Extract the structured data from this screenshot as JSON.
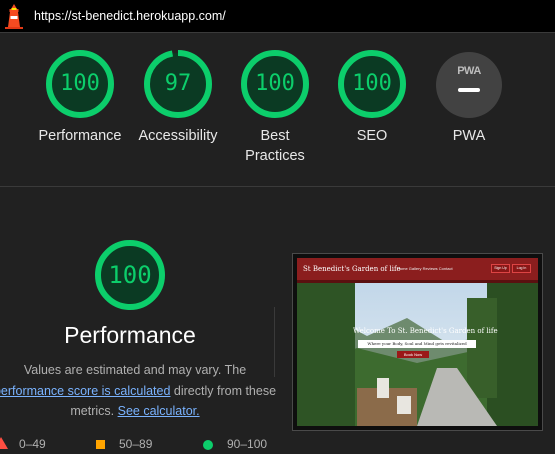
{
  "topbar": {
    "url": "https://st-benedict.herokuapp.com/"
  },
  "scores": [
    {
      "label": "Performance",
      "value": "100",
      "fraction": 1.0
    },
    {
      "label": "Accessibility",
      "value": "97",
      "fraction": 0.97
    },
    {
      "label": "Best Practices",
      "value": "100",
      "fraction": 1.0
    },
    {
      "label": "SEO",
      "value": "100",
      "fraction": 1.0
    }
  ],
  "pwa": {
    "label": "PWA",
    "badge_text": "PWA"
  },
  "detail": {
    "score": "100",
    "title": "Performance",
    "desc_prefix": "Values are estimated and may vary. The ",
    "link1": "performance score is calculated",
    "desc_middle": " directly from these metrics. ",
    "link2": "See calculator."
  },
  "screenshot": {
    "site_title": "St Benedict's Garden of life",
    "nav_links": "Home  Gallery  Reviews  Contact",
    "btn1": "Sign Up",
    "btn2": "Log In",
    "welcome": "Welcome To St. Benedict's Garden of life",
    "tagline": "Where your Body, Soul and Mind gets revitalized",
    "book": "Book Now"
  },
  "legend": [
    {
      "range": "0–49",
      "color": "#ff4e42"
    },
    {
      "range": "50–89",
      "color": "#ffa400"
    },
    {
      "range": "90–100",
      "color": "#0cce6b"
    }
  ],
  "colors": {
    "pass": "#0cce6b",
    "track": "#0b3a23",
    "link": "#7ab3ff"
  }
}
